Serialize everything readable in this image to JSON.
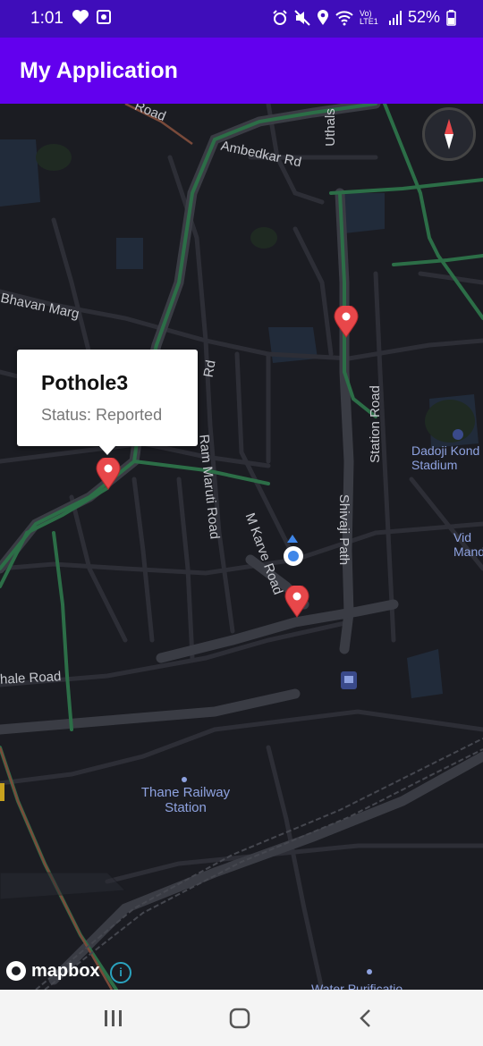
{
  "status_bar": {
    "time": "1:01",
    "battery": "52%",
    "left_icons": [
      "heart-icon",
      "camera-icon"
    ],
    "right_icons": [
      "alarm-icon",
      "mute-icon",
      "location-icon",
      "wifi-icon",
      "volte-lte-icon",
      "signal-icon",
      "battery-icon"
    ],
    "network_label": "Vo) LTE1"
  },
  "app_bar": {
    "title": "My Application"
  },
  "map": {
    "road_labels": {
      "road_top": "Road",
      "ambedkar": "Ambedkar Rd",
      "uthalsar": "Uthals",
      "bhavan": "Bhavan Marg",
      "ram_maruti": "Ram Maruti Road",
      "m_karve": "M Karve Road",
      "shivaji": "Shivaji Path",
      "station": "Station Road",
      "gokhale": "hale Road",
      "rd_frag": "Rd"
    },
    "poi_labels": {
      "dadoji": "Dadoji Kond Stadium",
      "vid": "Vid Mand",
      "thane_station": "Thane Railway Station",
      "water": "Water Purificatio"
    },
    "markers": [
      {
        "name": "Pothole3",
        "selected": true
      },
      {
        "name": "marker-2"
      },
      {
        "name": "marker-3"
      }
    ],
    "callout": {
      "title": "Pothole3",
      "status": "Status: Reported"
    },
    "attribution": {
      "logo_text": "mapbox",
      "info_icon": "i"
    }
  },
  "nav_bar": {
    "buttons": [
      "recent-apps-icon",
      "home-icon",
      "back-icon"
    ]
  },
  "colors": {
    "status_bar": "#3f0dba",
    "app_bar": "#6200ee",
    "map_bg": "#1b1c22",
    "marker": "#e8474a",
    "user_location": "#3f86e8",
    "green_road": "#2c6e47"
  }
}
